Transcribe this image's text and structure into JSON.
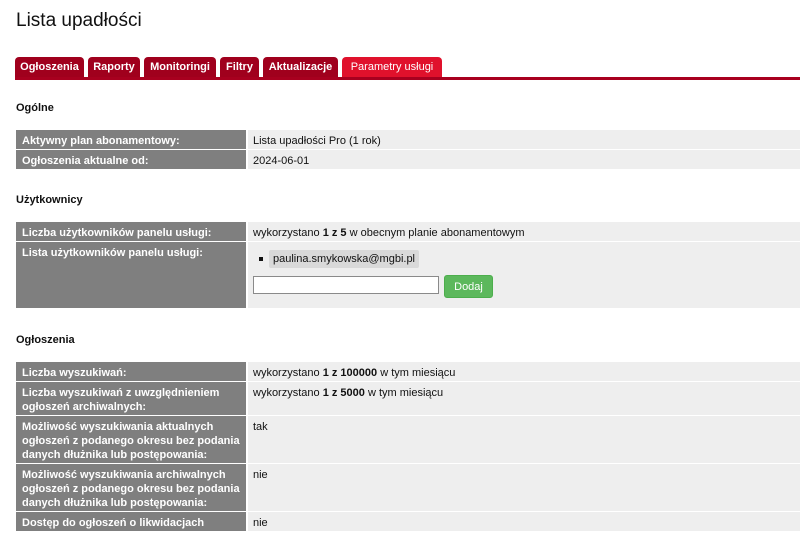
{
  "page": {
    "title": "Lista upadłości"
  },
  "tabs": [
    {
      "label": "Ogłoszenia",
      "active": false
    },
    {
      "label": "Raporty",
      "active": false
    },
    {
      "label": "Monitoringi",
      "active": false
    },
    {
      "label": "Filtry",
      "active": false
    },
    {
      "label": "Aktualizacje",
      "active": false
    },
    {
      "label": "Parametry usługi",
      "active": true
    }
  ],
  "colors": {
    "tab": "#a0001d",
    "tab_active": "#e0112c",
    "label_bg": "#7f7f7f",
    "value_bg": "#eeeeee",
    "button": "#5cb85c"
  },
  "sections": {
    "general": {
      "title": "Ogólne",
      "rows": [
        {
          "label": "Aktywny plan abonamentowy:",
          "value": "Lista upadłości Pro (1 rok)"
        },
        {
          "label": "Ogłoszenia aktualne od:",
          "value": "2024-06-01"
        }
      ]
    },
    "users": {
      "title": "Użytkownicy",
      "count_label": "Liczba użytkowników panelu usługi:",
      "count_prefix": "wykorzystano ",
      "count_bold": "1 z 5",
      "count_suffix": " w obecnym planie abonamentowym",
      "list_label": "Lista użytkowników panelu usługi:",
      "emails": [
        "paulina.smykowska@mgbi.pl"
      ],
      "new_user_value": "",
      "add_button": "Dodaj"
    },
    "announcements": {
      "title": "Ogłoszenia",
      "rows": [
        {
          "label": "Liczba wyszukiwań:",
          "prefix": "wykorzystano ",
          "bold": "1 z 100000",
          "suffix": " w tym miesiącu"
        },
        {
          "label": "Liczba wyszukiwań z uwzględnieniem ogłoszeń archiwalnych:",
          "prefix": "wykorzystano ",
          "bold": "1 z 5000",
          "suffix": " w tym miesiącu"
        },
        {
          "label": "Możliwość wyszukiwania aktualnych ogłoszeń z podanego okresu bez podania danych dłużnika lub postępowania:",
          "prefix": "tak",
          "bold": "",
          "suffix": ""
        },
        {
          "label": "Możliwość wyszukiwania archiwalnych ogłoszeń z podanego okresu bez podania danych dłużnika lub postępowania:",
          "prefix": "nie",
          "bold": "",
          "suffix": ""
        },
        {
          "label": "Dostęp do ogłoszeń o likwidacjach spółek:",
          "prefix": "nie",
          "bold": "",
          "suffix": ""
        }
      ]
    }
  }
}
